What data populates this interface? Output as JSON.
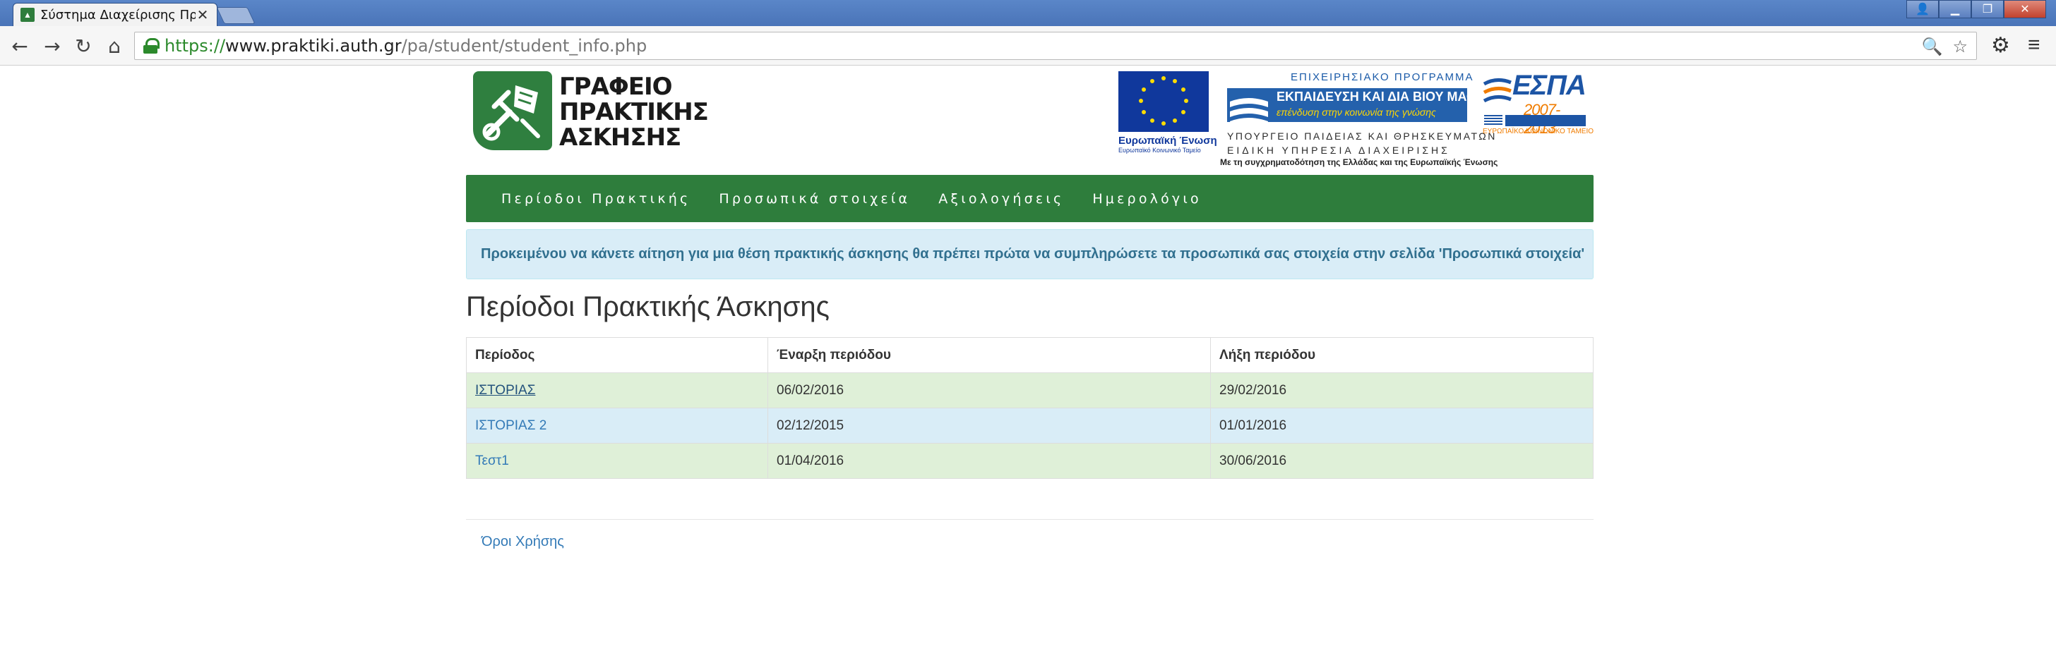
{
  "browser": {
    "tab_title": "Σύστημα Διαχείρισης Πρα",
    "tab_close": "✕",
    "url_scheme": "https://",
    "url_host": "www.praktiki.auth.gr",
    "url_path": "/pa/student/student_info.php"
  },
  "header": {
    "logo_line1": "ΓΡΑΦΕΙΟ",
    "logo_line2": "ΠΡΑΚΤΙΚΗΣ",
    "logo_line3": "ΑΣΚΗΣΗΣ",
    "eu_caption": "Ευρωπαϊκή Ένωση",
    "eu_sub": "Ευρωπαϊκό Κοινωνικό Ταμείο",
    "op_title": "ΕΠΙΧΕΙΡΗΣΙΑΚΟ ΠΡΟΓΡΑΜΜΑ",
    "op_bar_line1": "ΕΚΠΑΙΔΕΥΣΗ ΚΑΙ ΔΙΑ ΒΙΟΥ ΜΑΘΗΣΗ",
    "op_bar_line2": "επένδυση στην κοινωνία της γνώσης",
    "op_ministry": "ΥΠΟΥΡΓΕΙΟ ΠΑΙΔΕΙΑΣ ΚΑΙ ΘΡΗΣΚΕΥΜΑΤΩΝ",
    "op_special": "ΕΙΔΙΚΗ ΥΠΗΡΕΣΙΑ ΔΙΑΧΕΙΡΙΣΗΣ",
    "cofund": "Με τη συγχρηματοδότηση της Ελλάδας και της Ευρωπαϊκής Ένωσης",
    "espa_title": "ΕΣΠΑ",
    "espa_years": "2007-2013",
    "espa_fund": "ΕΥΡΩΠΑΪΚΟ ΚΟΙΝΩΝΙΚΟ ΤΑΜΕΙΟ"
  },
  "nav": {
    "items": [
      {
        "label": "Περίοδοι Πρακτικής"
      },
      {
        "label": "Προσωπικά στοιχεία"
      },
      {
        "label": "Αξιολογήσεις"
      },
      {
        "label": "Ημερολόγιο"
      }
    ]
  },
  "alert": {
    "text": "Προκειμένου να κάνετε αίτηση για μια θέση πρακτικής άσκησης θα πρέπει πρώτα να συμπληρώσετε τα προσωπικά σας στοιχεία στην σελίδα 'Προσωπικά στοιχεία'"
  },
  "main": {
    "title": "Περίοδοι Πρακτικής Άσκησης",
    "table": {
      "headers": [
        "Περίοδος",
        "Έναρξη περιόδου",
        "Λήξη περιόδου"
      ],
      "rows": [
        {
          "period": "ΙΣΤΟΡΙΑΣ",
          "start": "06/02/2016",
          "end": "29/02/2016"
        },
        {
          "period": "ΙΣΤΟΡΙΑΣ 2",
          "start": "02/12/2015",
          "end": "01/01/2016"
        },
        {
          "period": "Τεστ1",
          "start": "01/04/2016",
          "end": "30/06/2016"
        }
      ]
    }
  },
  "footer": {
    "terms": "Όροι Χρήσης"
  },
  "colors": {
    "nav_green": "#2e7d3c",
    "alert_bg": "#d9edf7",
    "alert_text": "#31708f",
    "row_success": "#dff0d8",
    "row_info": "#d9edf7",
    "link": "#337ab7"
  }
}
